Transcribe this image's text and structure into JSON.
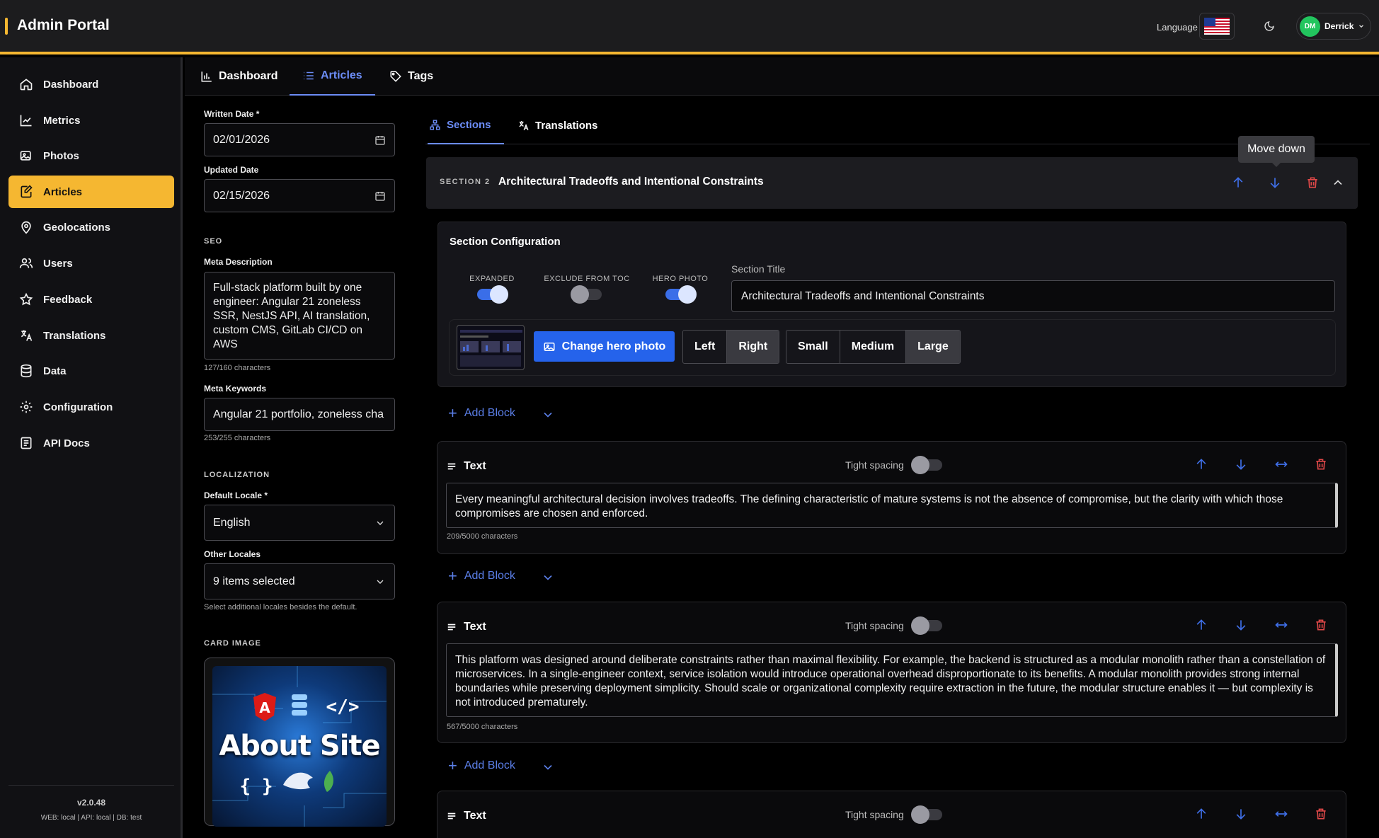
{
  "header": {
    "brand": "Admin Portal",
    "language_label": "Language",
    "user": {
      "initials": "DM",
      "name": "Derrick"
    }
  },
  "sidebar": {
    "items": [
      {
        "label": "Dashboard",
        "icon": "home-icon"
      },
      {
        "label": "Metrics",
        "icon": "chart-line-icon"
      },
      {
        "label": "Photos",
        "icon": "photos-icon"
      },
      {
        "label": "Articles",
        "icon": "edit-icon",
        "active": true
      },
      {
        "label": "Geolocations",
        "icon": "location-pin-icon"
      },
      {
        "label": "Users",
        "icon": "users-icon"
      },
      {
        "label": "Feedback",
        "icon": "star-icon"
      },
      {
        "label": "Translations",
        "icon": "translate-icon"
      },
      {
        "label": "Data",
        "icon": "database-icon"
      },
      {
        "label": "Configuration",
        "icon": "gear-icon"
      },
      {
        "label": "API Docs",
        "icon": "document-icon"
      }
    ],
    "version": "v2.0.48",
    "env": "WEB: local | API: local | DB: test"
  },
  "subtabs": [
    {
      "label": "Dashboard"
    },
    {
      "label": "Articles",
      "active": true
    },
    {
      "label": "Tags"
    }
  ],
  "form": {
    "written_date": {
      "label": "Written Date *",
      "value": "02/01/2026"
    },
    "updated_date": {
      "label": "Updated Date",
      "value": "02/15/2026"
    },
    "seo_heading": "SEO",
    "meta_description": {
      "label": "Meta Description",
      "value": "Full-stack platform built by one engineer: Angular 21 zoneless SSR, NestJS API, AI translation, custom CMS, GitLab CI/CD on AWS",
      "count": "127/160 characters"
    },
    "meta_keywords": {
      "label": "Meta Keywords",
      "value": "Angular 21 portfolio, zoneless cha",
      "count": "253/255 characters"
    },
    "localization_heading": "LOCALIZATION",
    "default_locale": {
      "label": "Default Locale *",
      "value": "English"
    },
    "other_locales": {
      "label": "Other Locales",
      "value": "9 items selected",
      "hint": "Select additional locales besides the default."
    },
    "card_image_heading": "CARD IMAGE",
    "card_image_text": "About Site"
  },
  "right_tabs": [
    {
      "label": "Sections",
      "active": true
    },
    {
      "label": "Translations"
    }
  ],
  "section": {
    "tag": "SECTION 2",
    "title": "Architectural Tradeoffs and Intentional Constraints",
    "tooltip": "Move down",
    "config": {
      "heading": "Section Configuration",
      "expanded": {
        "label": "EXPANDED",
        "on": true
      },
      "exclude_toc": {
        "label": "EXCLUDE FROM TOC",
        "on": false
      },
      "hero_photo": {
        "label": "HERO PHOTO",
        "on": true
      },
      "section_title_label": "Section Title",
      "section_title_value": "Architectural Tradeoffs and Intentional Constraints",
      "change_hero_label": "Change hero photo",
      "alignment": {
        "options": [
          "Left",
          "Right"
        ],
        "selected": "Right"
      },
      "size": {
        "options": [
          "Small",
          "Medium",
          "Large"
        ],
        "selected": "Large"
      }
    }
  },
  "add_block_label": "Add Block",
  "blocks": [
    {
      "type": "Text",
      "tight_label": "Tight spacing",
      "text": "Every meaningful architectural decision involves tradeoffs. The defining characteristic of mature systems is not the absence of compromise, but the clarity with which those compromises are chosen and enforced.",
      "count": "209/5000 characters"
    },
    {
      "type": "Text",
      "tight_label": "Tight spacing",
      "text": "This platform was designed around deliberate constraints rather than maximal flexibility. For example, the backend is structured as a modular monolith rather than a constellation of microservices. In a single-engineer context, service isolation would introduce operational overhead disproportionate to its benefits. A modular monolith provides strong internal boundaries while preserving deployment simplicity. Should scale or organizational complexity require extraction in the future, the modular structure enables it — but complexity is not introduced prematurely.",
      "count": "567/5000 characters"
    },
    {
      "type": "Text",
      "tight_label": "Tight spacing"
    }
  ],
  "colors": {
    "accent": "#f5b731",
    "link": "#6b8cf5",
    "primary_button": "#2563eb",
    "danger": "#e04848"
  }
}
